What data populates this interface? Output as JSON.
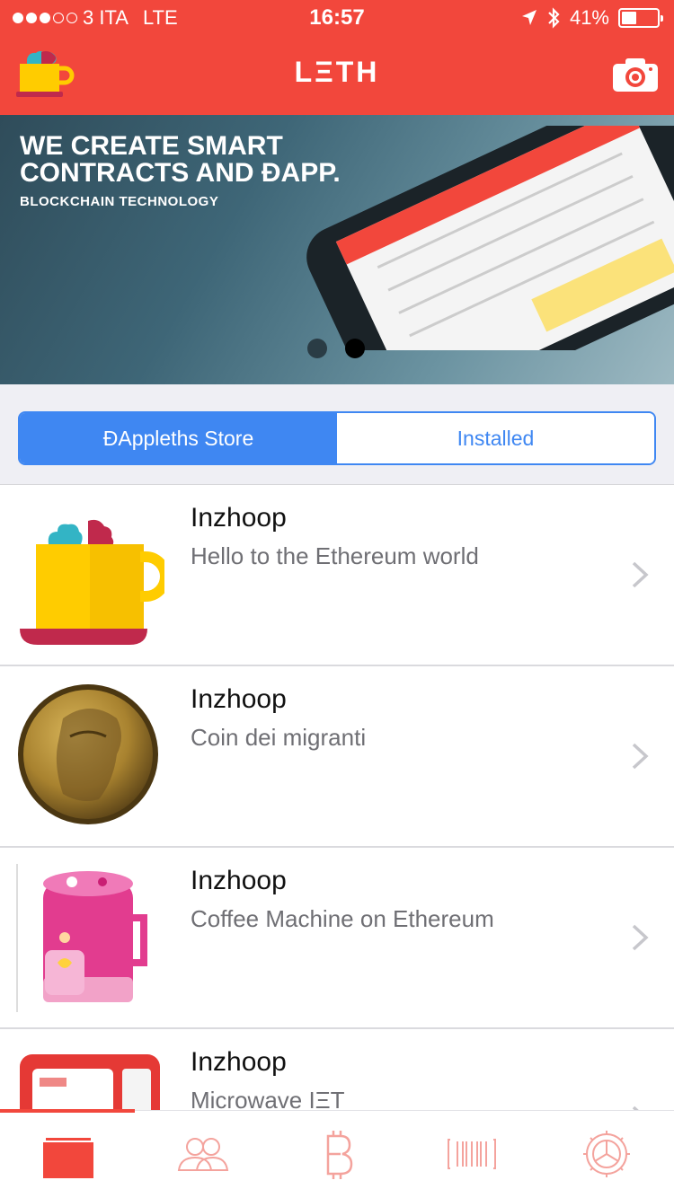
{
  "status_bar": {
    "carrier": "3 ITA",
    "network": "LTE",
    "time": "16:57",
    "battery": "41%",
    "battery_level": 0.41,
    "signal_bars": 3
  },
  "nav": {
    "title": "LΞTH",
    "left_icon": "leth-logo-cup-icon",
    "right_icon": "camera-icon"
  },
  "banner": {
    "headline": "WE CREATE SMART\nCONTRACTS AND ĐAPP.",
    "subheadline": "BLOCKCHAIN TECHNOLOGY",
    "pages": 2,
    "active_page": 2
  },
  "segment": {
    "store_label": "ĐAppleths Store",
    "installed_label": "Installed",
    "selected": "store"
  },
  "items": [
    {
      "title": "Inzhoop",
      "subtitle": "Hello to the Ethereum world",
      "icon": "brain-cup-icon"
    },
    {
      "title": "Inzhoop",
      "subtitle": "Coin dei migranti",
      "icon": "bronze-coin-icon"
    },
    {
      "title": "Inzhoop",
      "subtitle": "Coffee Machine on Ethereum",
      "icon": "pink-coffee-machine-icon"
    },
    {
      "title": "Inzhoop",
      "subtitle": "Microwave IΞT",
      "icon": "microwave-icon"
    }
  ],
  "tabs": [
    {
      "icon": "wallet-icon",
      "active": true
    },
    {
      "icon": "contacts-icon",
      "active": false
    },
    {
      "icon": "bitcoin-icon",
      "active": false
    },
    {
      "icon": "barcode-icon",
      "active": false
    },
    {
      "icon": "settings-icon",
      "active": false
    }
  ],
  "colors": {
    "brand_red": "#f2473c",
    "segment_blue": "#3f87f2",
    "tab_inactive": "#f4a39d"
  }
}
